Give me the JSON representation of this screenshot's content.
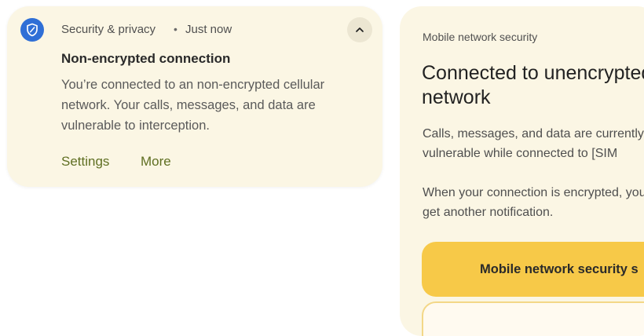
{
  "notification": {
    "app_name": "Security & privacy",
    "separator": "•",
    "time": "Just now",
    "title": "Non-encrypted connection",
    "body": "You’re connected to an non-encrypted cellular network. Your calls, messages, and data are vulnerable to interception.",
    "actions": {
      "settings": "Settings",
      "more": "More"
    },
    "icons": {
      "app": "shield-icon",
      "expand": "chevron-up-icon"
    }
  },
  "detail_panel": {
    "header": "Mobile network security",
    "title": "Connected to unencrypted network",
    "paragraph_1": "Calls, messages, and data are currently vulnerable while connected to [SIM",
    "paragraph_2": "When your connection is encrypted, you'll get another notification.",
    "primary_button": "Mobile network security s"
  },
  "colors": {
    "card_background": "#fbf6e4",
    "app_icon": "#2f6fd6",
    "action_text": "#5f6f22",
    "primary_button": "#f7c948"
  }
}
